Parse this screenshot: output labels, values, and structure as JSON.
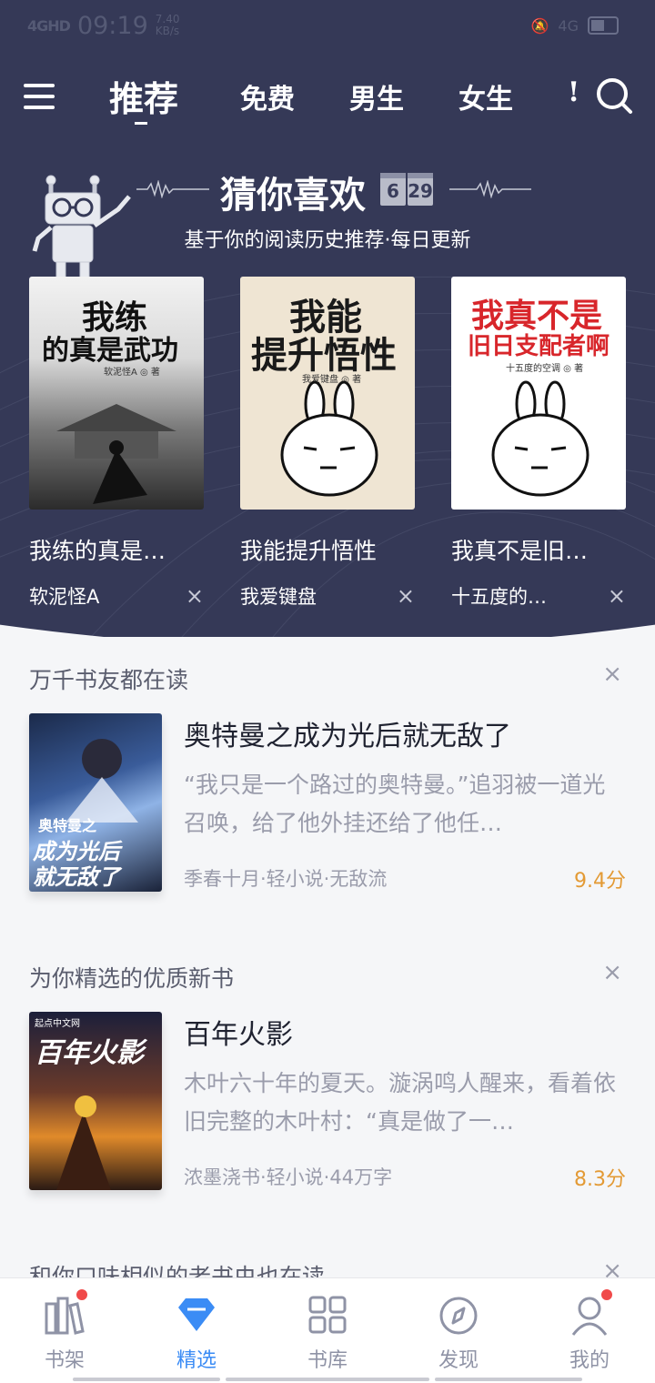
{
  "status_bar": {
    "signal": "4GHD",
    "time": "09:19",
    "speed_top": "7.40",
    "speed_bottom": "KB/s",
    "network": "4G"
  },
  "nav": {
    "tabs": [
      {
        "label": "推荐",
        "active": true
      },
      {
        "label": "免费"
      },
      {
        "label": "男生"
      },
      {
        "label": "女生"
      },
      {
        "label": "!"
      }
    ]
  },
  "guess": {
    "title": "猜你喜欢",
    "date_month": "6",
    "date_day": "29",
    "subtitle": "基于你的阅读历史推荐·每日更新",
    "books": [
      {
        "name": "我练的真是…",
        "author": "软泥怪A",
        "cover_line1": "我练",
        "cover_line2": "的真是武功",
        "cover_author": "软泥怪A ◎ 著"
      },
      {
        "name": "我能提升悟性",
        "author": "我爱键盘",
        "cover_line1": "我能",
        "cover_line2": "提升悟性",
        "cover_author": "我爱键盘 ◎ 著"
      },
      {
        "name": "我真不是旧…",
        "author": "十五度的…",
        "cover_line1": "我真不是",
        "cover_line2": "旧日支配者啊",
        "cover_author": "十五度的空调 ◎ 著"
      }
    ],
    "close_glyph": "×"
  },
  "sections": [
    {
      "title": "万千书友都在读",
      "book": {
        "title": "奥特曼之成为光后就无敌了",
        "desc": "“我只是一个路过的奥特曼。”追羽被一道光召唤，给了他外挂还给了他任…",
        "meta": "季春十月·轻小说·无敌流",
        "score": "9.4分",
        "cover_text1": "奥特曼之",
        "cover_text2": "成为光后",
        "cover_text3": "就无敌了"
      }
    },
    {
      "title": "为你精选的优质新书",
      "book": {
        "title": "百年火影",
        "desc": "木叶六十年的夏天。漩涡鸣人醒来，看着依旧完整的木叶村：“真是做了一…",
        "meta": "浓墨浇书·轻小说·44万字",
        "score": "8.3分",
        "cover_text1": "百年火影",
        "cover_text2": "起点中文网"
      }
    },
    {
      "title": "和你口味相似的老书虫也在读"
    }
  ],
  "tabbar": {
    "items": [
      {
        "label": "书架",
        "badge": true
      },
      {
        "label": "精选",
        "active": true
      },
      {
        "label": "书库"
      },
      {
        "label": "发现"
      },
      {
        "label": "我的",
        "badge": true
      }
    ]
  },
  "colors": {
    "header_bg": "#353957",
    "accent_blue": "#3b8cf5",
    "score_orange": "#e39a35",
    "badge_red": "#f04a4a"
  }
}
